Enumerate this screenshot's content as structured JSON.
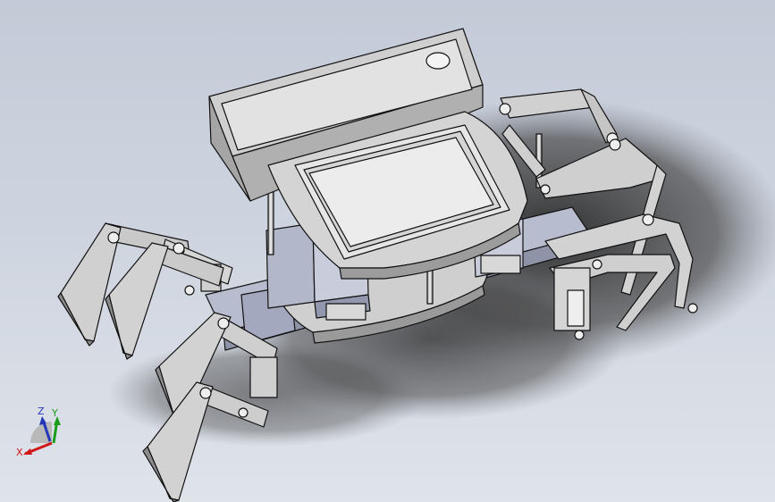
{
  "viewport": {
    "background_top": "#c4cbd8",
    "background_bottom": "#dfe3ea"
  },
  "model": {
    "description_icon": "hexapod-robot-assembly",
    "part_fill": "#d8d8d8",
    "part_shadow_fill": "#8e8e8e",
    "blue_part_fill": "#b8bccf",
    "edge_color": "#111111"
  },
  "triad": {
    "x_label": "X",
    "y_label": "Y",
    "z_label": "Z",
    "x_color": "#d01818",
    "y_color": "#1a9c1a",
    "z_color": "#2436b8"
  }
}
